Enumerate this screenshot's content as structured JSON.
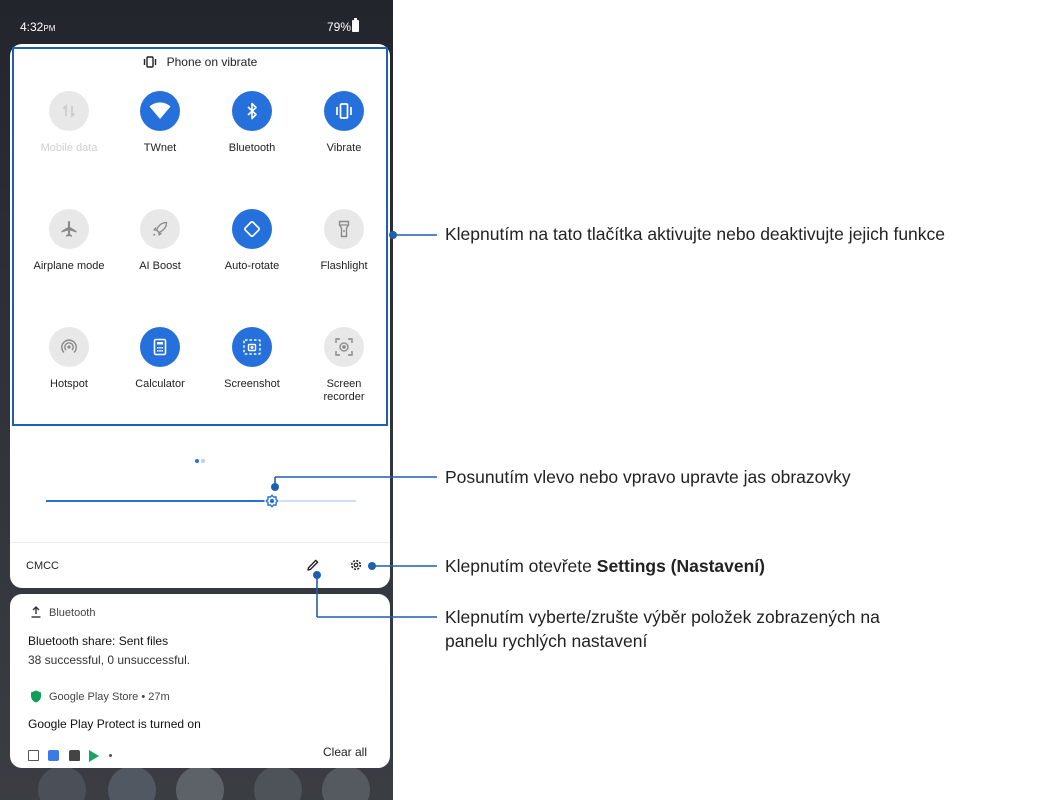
{
  "status_bar": {
    "time": "4:32",
    "time_suffix": "PM",
    "battery": "79%"
  },
  "quick_settings": {
    "header": "Phone on vibrate",
    "tiles": [
      {
        "label": "Mobile data",
        "state": "disabled",
        "icon": "mobile-data-icon"
      },
      {
        "label": "TWnet",
        "state": "on",
        "icon": "wifi-icon"
      },
      {
        "label": "Bluetooth",
        "state": "on",
        "icon": "bluetooth-icon"
      },
      {
        "label": "Vibrate",
        "state": "on",
        "icon": "vibrate-icon"
      },
      {
        "label": "Airplane mode",
        "state": "off",
        "icon": "airplane-icon"
      },
      {
        "label": "AI Boost",
        "state": "off",
        "icon": "rocket-icon"
      },
      {
        "label": "Auto-rotate",
        "state": "on",
        "icon": "rotate-icon"
      },
      {
        "label": "Flashlight",
        "state": "off",
        "icon": "flashlight-icon"
      },
      {
        "label": "Hotspot",
        "state": "off",
        "icon": "hotspot-icon"
      },
      {
        "label": "Calculator",
        "state": "on",
        "icon": "calculator-icon"
      },
      {
        "label": "Screenshot",
        "state": "on",
        "icon": "screenshot-icon"
      },
      {
        "label": "Screen recorder",
        "state": "off",
        "icon": "screen-recorder-icon"
      }
    ],
    "page_indicator": {
      "pages": 2,
      "current": 1
    },
    "brightness": {
      "level": 0.73
    },
    "carrier": "CMCC"
  },
  "notifications": {
    "bluetooth": {
      "app": "Bluetooth",
      "title": "Bluetooth share: Sent files",
      "text": "38 successful, 0 unsuccessful."
    },
    "play_store": {
      "app": "Google Play Store • 27m",
      "title": "Google Play Protect is turned on"
    },
    "clear_all": "Clear all"
  },
  "callouts": {
    "tiles": "Klepnutím na tato tlačítka aktivujte nebo deaktivujte jejich funkce",
    "brightness": "Posunutím vlevo nebo vpravo upravte jas obrazovky",
    "settings_prefix": "Klepnutím otevřete",
    "settings_bold": "Settings (Nastavení)",
    "edit_line1": "Klepnutím vyberte/zrušte výběr položek zobrazených na",
    "edit_line2": "panelu rychlých nastavení"
  },
  "colors": {
    "accent": "#2670db",
    "callout_line": "#1f5fb0",
    "tile_off": "#e8e8e8"
  }
}
